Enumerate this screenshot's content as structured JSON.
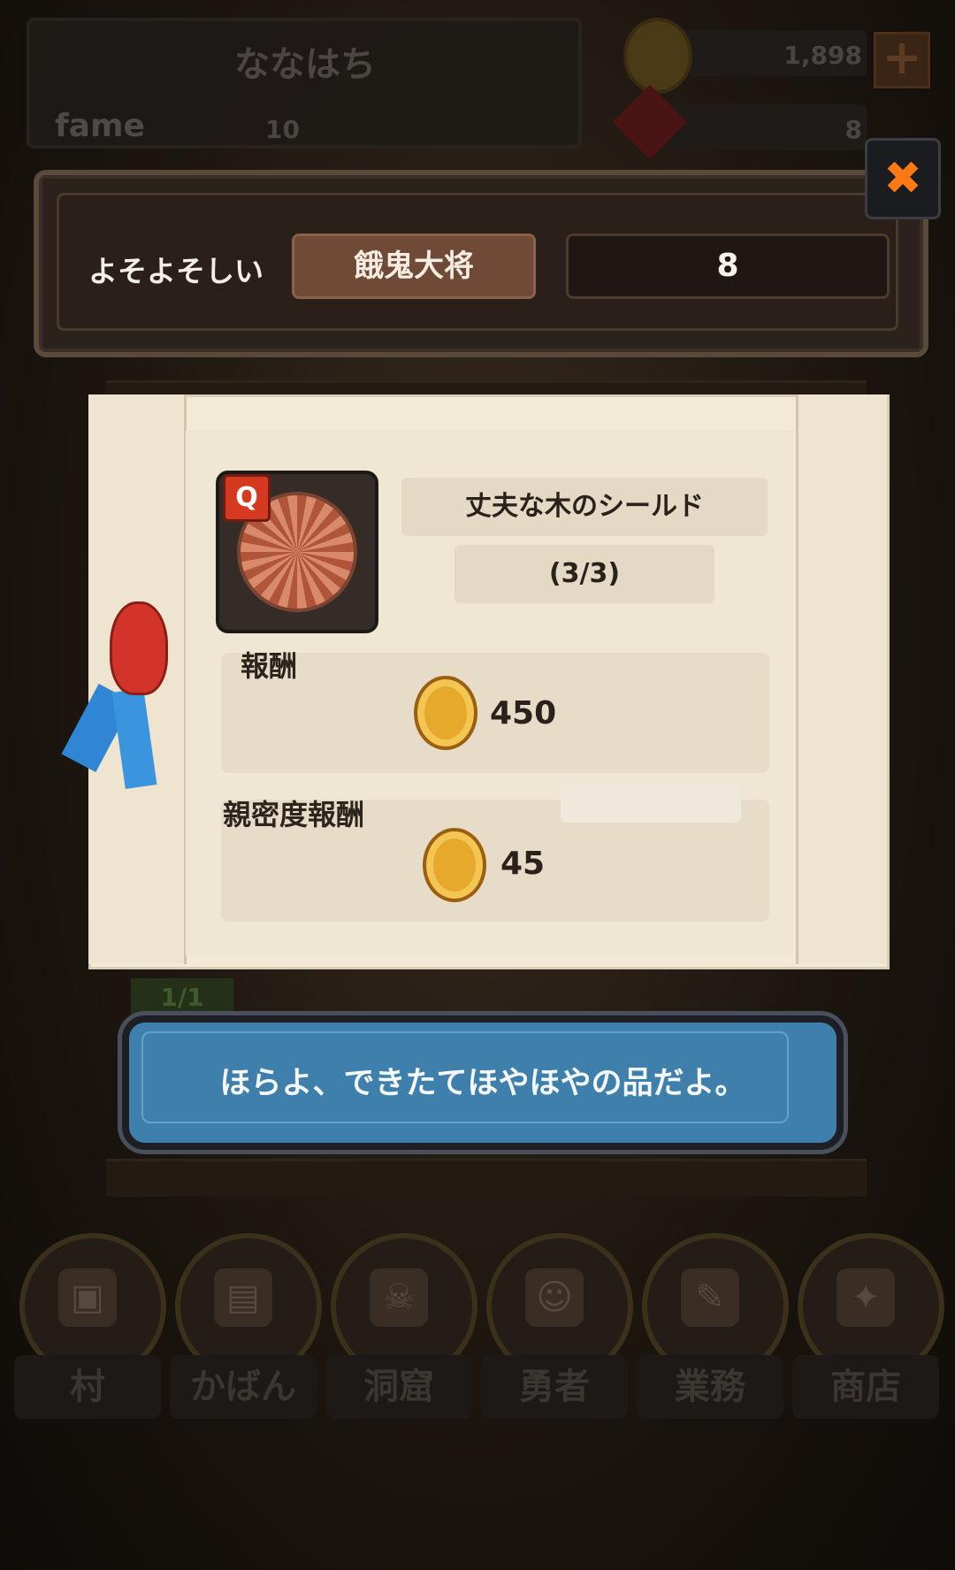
{
  "header": {
    "player_name": "ななはち",
    "fame_label": "fame",
    "fame_value": "10",
    "gold": "1,898",
    "gems": "8",
    "add_symbol": "+"
  },
  "banner": {
    "greeting": "よそよそしい",
    "title": "餓鬼大将",
    "level": "8",
    "close_symbol": "✖"
  },
  "quest": {
    "quality_badge": "Q",
    "item_name": "丈夫な木のシールド",
    "progress": "(3/3)",
    "reward_label": "報酬",
    "reward_value": "450",
    "affinity_label": "親密度報酬",
    "affinity_value": "45"
  },
  "background": {
    "progress_tag": "1/1"
  },
  "dialog": {
    "text": "ほらよ、できたてほやほやの品だよ。"
  },
  "nav": {
    "items": [
      {
        "label": "村",
        "icon": "lock-icon"
      },
      {
        "label": "かばん",
        "icon": "bag-icon"
      },
      {
        "label": "洞窟",
        "icon": "cave-icon"
      },
      {
        "label": "勇者",
        "icon": "hero-icon"
      },
      {
        "label": "業務",
        "icon": "tasks-icon"
      },
      {
        "label": "商店",
        "icon": "shop-icon"
      }
    ]
  },
  "colors": {
    "dialog_blue": "#3e80ab",
    "coin_gold": "#e7a92c",
    "close_orange": "#ff7a14",
    "parchment": "#f2e9d7"
  }
}
